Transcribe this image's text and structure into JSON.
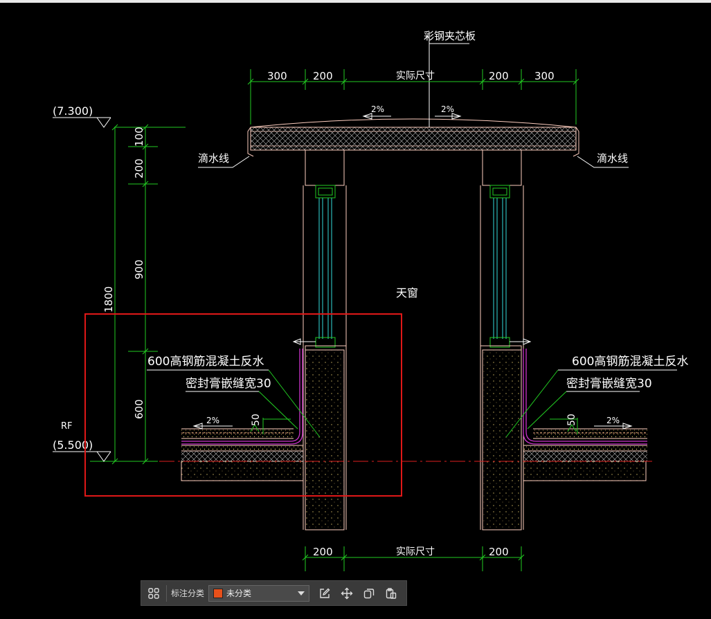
{
  "drawing": {
    "roof_panel_label": "彩钢夹芯板",
    "skylight_label": "天窗",
    "drip_line_left": "滴水线",
    "drip_line_right": "滴水线",
    "upstand_left": "600高钢筋混凝土反水",
    "upstand_right": "600高钢筋混凝土反水",
    "sealant_left": "密封膏嵌缝宽30",
    "sealant_right": "密封膏嵌缝宽30",
    "elev_top": "(7.300)",
    "elev_bottom": "(5.500)",
    "rf_label": "RF",
    "top_dims": [
      "300",
      "200",
      "实际尺寸",
      "200",
      "300"
    ],
    "bottom_dims": [
      "200",
      "实际尺寸",
      "200"
    ],
    "vert_dims": [
      "100",
      "200",
      "900",
      "600"
    ],
    "total_height": "1800",
    "slope_top_left": "2%",
    "slope_top_right": "2%",
    "slope_left": "2%",
    "slope_right": "2%",
    "upstand_dim": "50",
    "colors": {
      "dimension": "#22cc22",
      "outline": "#ffcfc0",
      "text": "#ffffff",
      "glass": "#33dddd",
      "membrane": "#cc33cc",
      "highlight": "#e01818"
    }
  },
  "toolbar": {
    "label": "标注分类",
    "category_value": "未分类",
    "category_color": "#e8501a",
    "icons": [
      "grid-icon",
      "edit-icon",
      "move-icon",
      "copy-icon",
      "paste-icon"
    ]
  }
}
